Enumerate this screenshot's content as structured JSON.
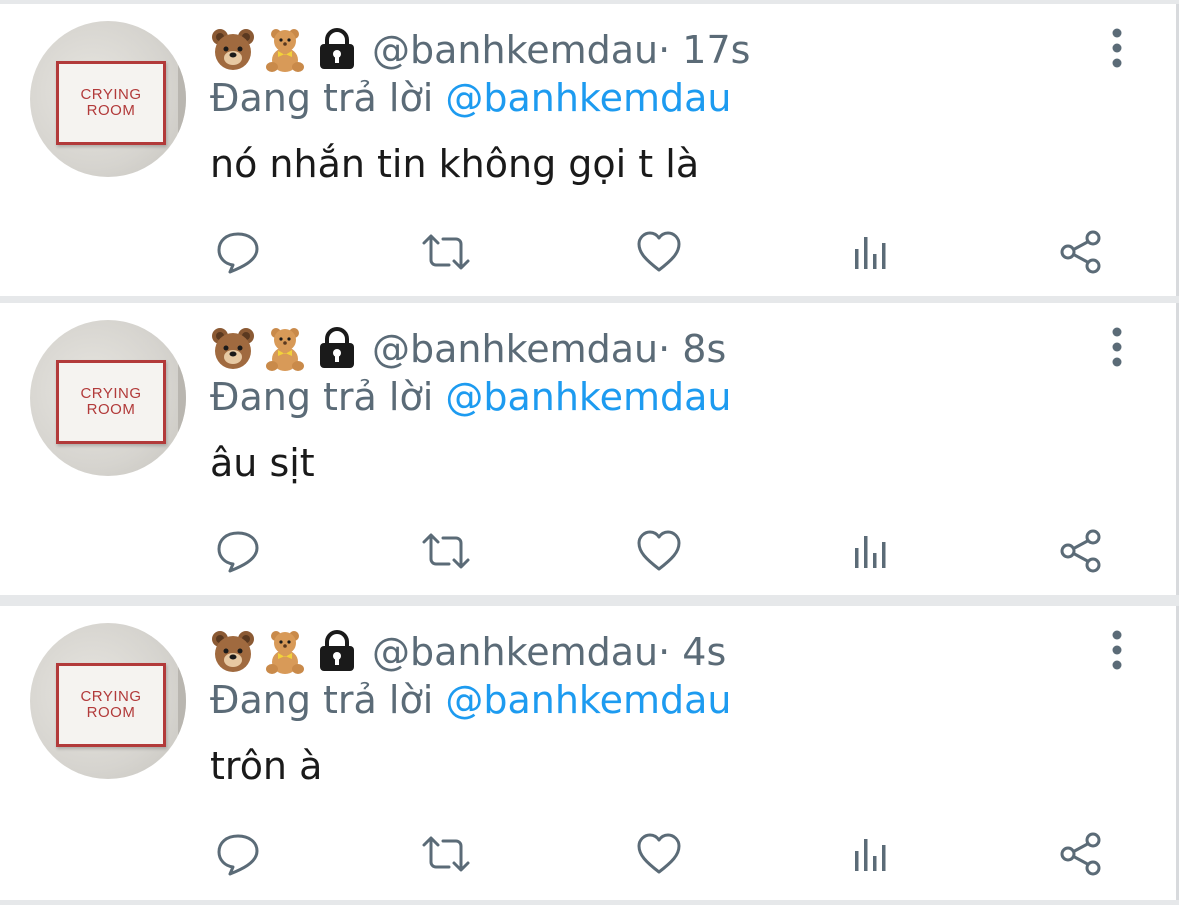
{
  "colors": {
    "muted": "#5b6b77",
    "mention": "#1d9bf0",
    "text": "#1a1a1a",
    "divider": "#e6e8ea",
    "sign_red": "#b23a3a"
  },
  "avatar_sign": {
    "line1": "CRYING",
    "line2": "ROOM"
  },
  "icons": {
    "header": [
      "bear-face-icon",
      "teddy-bear-icon",
      "lock-icon"
    ],
    "menu": "more-vertical-icon",
    "actions": [
      "reply-icon",
      "retweet-icon",
      "like-icon",
      "views-icon",
      "share-icon"
    ]
  },
  "tweets": [
    {
      "handle": "@banhkemdau",
      "time": "· 17s",
      "reply_prefix": "Đang trả lời ",
      "reply_to": "@banhkemdau",
      "text": "nó nhắn tin không gọi t là"
    },
    {
      "handle": "@banhkemdau",
      "time": "· 8s",
      "reply_prefix": "Đang trả lời ",
      "reply_to": "@banhkemdau",
      "text": "âu sịt"
    },
    {
      "handle": "@banhkemdau",
      "time": "· 4s",
      "reply_prefix": "Đang trả lời ",
      "reply_to": "@banhkemdau",
      "text": "trôn à"
    }
  ]
}
